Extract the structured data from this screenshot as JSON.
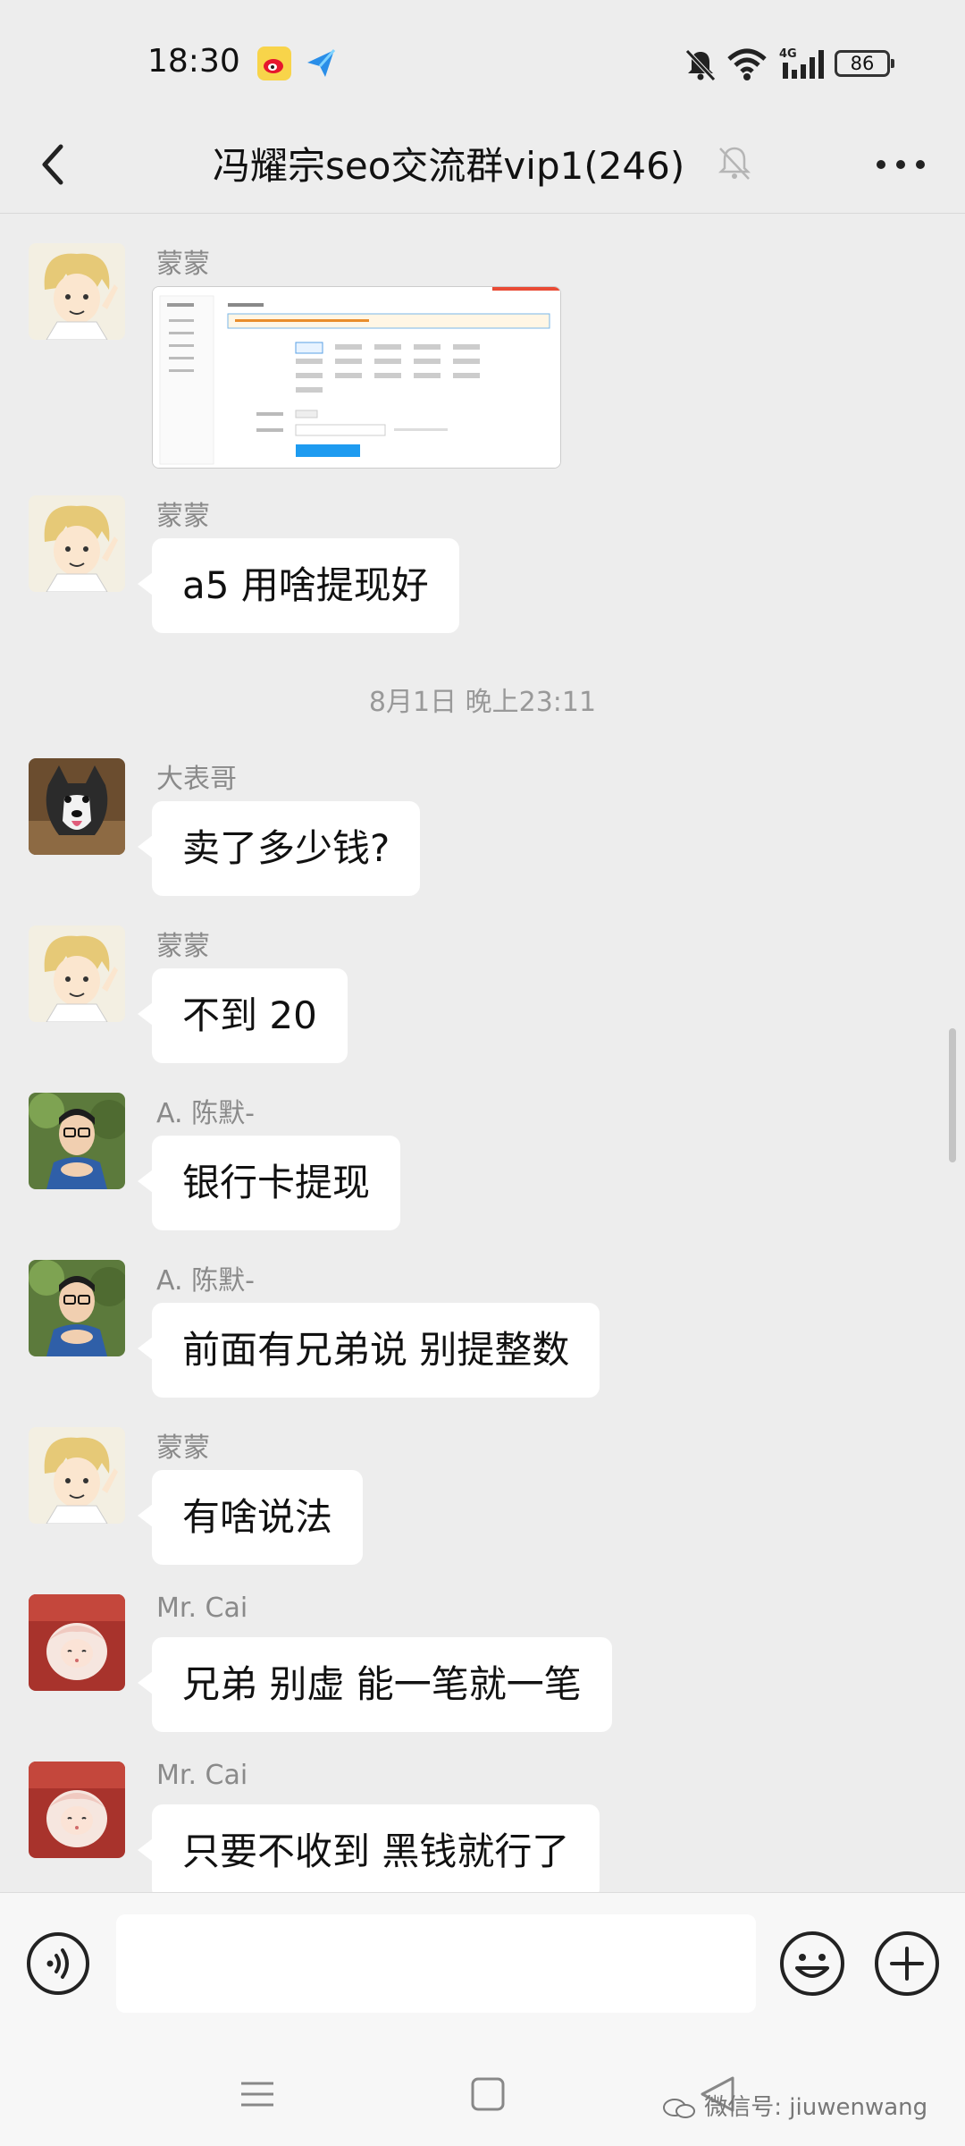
{
  "status_bar": {
    "time": "18:30",
    "network": "4G",
    "battery": "86"
  },
  "header": {
    "title": "冯耀宗seo交流群vip1(246)"
  },
  "messages": [
    {
      "sender": "蒙蒙",
      "type": "image"
    },
    {
      "sender": "蒙蒙",
      "text": "a5 用啥提现好"
    },
    {
      "timestamp": "8月1日 晚上23:11"
    },
    {
      "sender": "大表哥",
      "text": "卖了多少钱?"
    },
    {
      "sender": "蒙蒙",
      "text": "不到 20"
    },
    {
      "sender": "A. 陈默-",
      "text": "银行卡提现"
    },
    {
      "sender": "A. 陈默-",
      "text": "前面有兄弟说 别提整数"
    },
    {
      "sender": "蒙蒙",
      "text": "有啥说法"
    },
    {
      "sender": "Mr. Cai",
      "text": "兄弟 别虚 能一笔就一笔"
    },
    {
      "sender": "Mr. Cai",
      "text": "只要不收到 黑钱就行了"
    }
  ],
  "input": {
    "placeholder": ""
  },
  "watermark": "微信号: jiuwenwang",
  "colors": {
    "bg": "#ededed",
    "bubble": "#ffffff",
    "sender": "#8a8a8a"
  }
}
